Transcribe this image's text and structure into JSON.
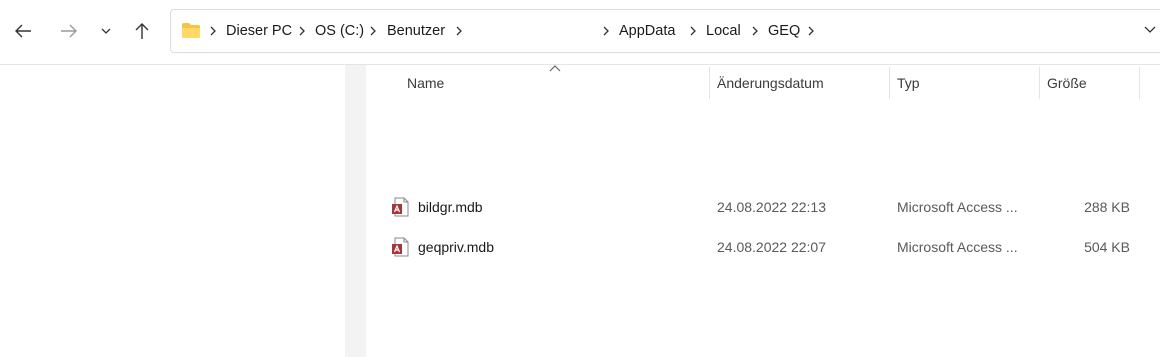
{
  "toolbar": {
    "back_icon": "arrow-left-icon",
    "forward_icon": "arrow-right-icon",
    "recent_icon": "chevron-down-icon",
    "up_icon": "arrow-up-icon"
  },
  "address_bar": {
    "folder_icon": "folder-icon",
    "crumbs": [
      "Dieser PC",
      "OS (C:)",
      "Benutzer",
      "AppData",
      "Local",
      "GEQ"
    ],
    "dropdown_icon": "chevron-down-icon"
  },
  "columns": {
    "name": "Name",
    "modified": "Änderungsdatum",
    "type": "Typ",
    "size": "Größe",
    "sort_icon": "sort-up-caret-icon"
  },
  "files": [
    {
      "name": "bildgr.mdb",
      "modified": "24.08.2022 22:13",
      "type": "Microsoft Access ...",
      "size": "288 KB",
      "icon": "access-database-icon"
    },
    {
      "name": "geqpriv.mdb",
      "modified": "24.08.2022 22:07",
      "type": "Microsoft Access ...",
      "size": "504 KB",
      "icon": "access-database-icon"
    }
  ],
  "colors": {
    "folder": "#f6c343",
    "access_icon": "#a4373a"
  }
}
